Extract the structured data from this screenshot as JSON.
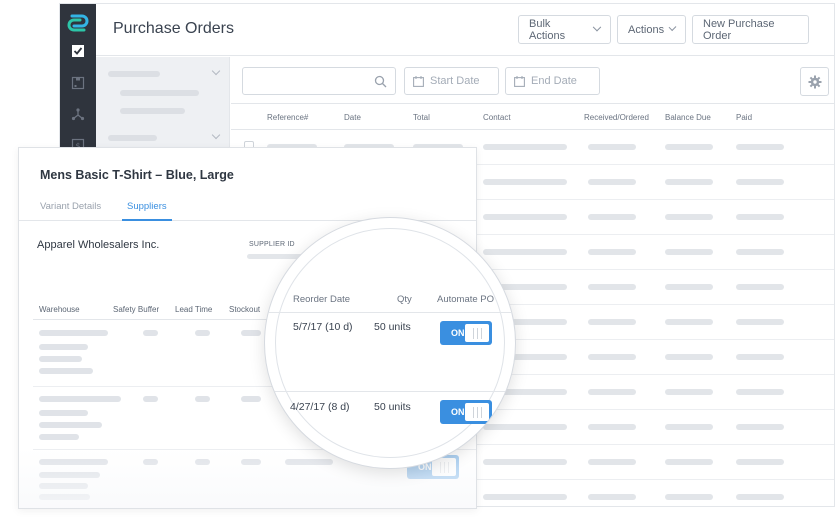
{
  "app": {
    "title": "Purchase Orders",
    "header_buttons": {
      "bulk_actions": "Bulk Actions",
      "actions": "Actions",
      "new_po": "New Purchase Order"
    },
    "sidebar_icons": [
      "logo-icon",
      "checklist-icon",
      "box-icon",
      "network-icon",
      "dollar-icon"
    ]
  },
  "toolbar": {
    "search_placeholder": "",
    "start_date_placeholder": "Start Date",
    "end_date_placeholder": "End Date"
  },
  "po_table": {
    "columns": [
      "Reference#",
      "Date",
      "Total",
      "Contact",
      "Received/Ordered",
      "Balance Due",
      "Paid"
    ],
    "row_count": 11
  },
  "variant_card": {
    "title": "Mens Basic T-Shirt – Blue, Large",
    "tabs": [
      {
        "label": "Variant Details",
        "active": false
      },
      {
        "label": "Suppliers",
        "active": true
      }
    ],
    "supplier_name": "Apparel Wholesalers Inc.",
    "supplier_id_label": "SUPPLIER ID",
    "warehouse_columns": [
      "Warehouse",
      "Safety Buffer",
      "Lead Time",
      "Stockout"
    ]
  },
  "magnifier": {
    "columns": [
      "Reorder Date",
      "Qty",
      "Automate PO"
    ],
    "rows": [
      {
        "reorder_date": "5/7/17 (10 d)",
        "qty": "50 units",
        "automate": "ON"
      },
      {
        "reorder_date": "4/27/17 (8 d)",
        "qty": "50 units",
        "automate": "ON"
      }
    ]
  },
  "colors": {
    "accent": "#3a8fe0",
    "sidebar": "#2f343d",
    "skeleton": "#e2e5e9"
  }
}
